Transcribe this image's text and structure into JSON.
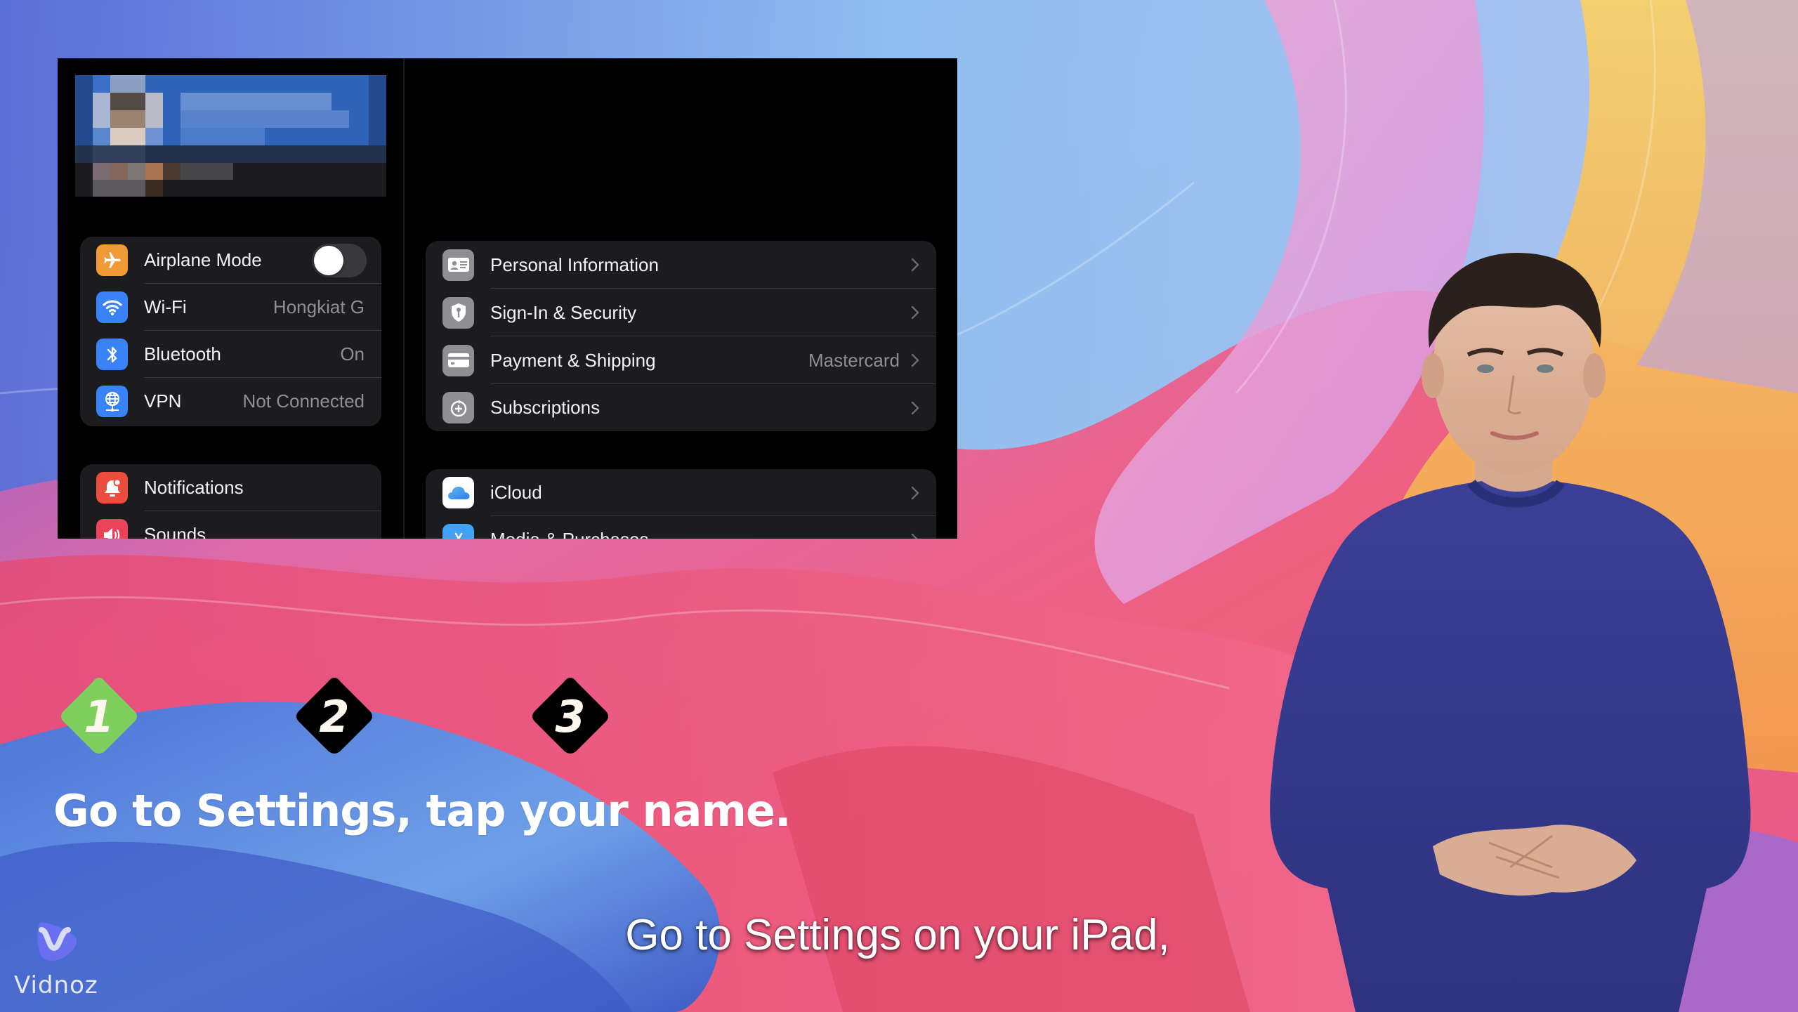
{
  "background": {
    "description": "abstract colorful wavy gradient wallpaper",
    "colors": [
      "#5b7fdc",
      "#8fbff2",
      "#e879b6",
      "#f2c25a",
      "#ee5f7a",
      "#9b6fd8"
    ]
  },
  "settings_panel": {
    "profile": {
      "state": "pixelated/blurred",
      "colors": [
        "#2f63b8",
        "#3f74c9",
        "#6e92d2",
        "#24324d",
        "#1e1e20"
      ]
    },
    "sidebar": {
      "groups": [
        {
          "items": [
            {
              "label": "Airplane Mode",
              "icon": "airplane-icon",
              "icon_color": "#f09a37",
              "toggle": true,
              "toggle_on": false
            },
            {
              "label": "Wi-Fi",
              "icon": "wifi-icon",
              "icon_color": "#3a82f7",
              "value": "Hongkiat G"
            },
            {
              "label": "Bluetooth",
              "icon": "bluetooth-icon",
              "icon_color": "#3a82f7",
              "value": "On"
            },
            {
              "label": "VPN",
              "icon": "vpn-globe-icon",
              "icon_color": "#3a82f7",
              "value": "Not Connected"
            }
          ]
        },
        {
          "items": [
            {
              "label": "Notifications",
              "icon": "bell-icon",
              "icon_color": "#eb4d3d"
            },
            {
              "label": "Sounds",
              "icon": "speaker-icon",
              "icon_color": "#eb445a"
            }
          ]
        }
      ]
    },
    "detail": {
      "groups": [
        {
          "items": [
            {
              "label": "Personal Information",
              "icon": "contact-card-icon",
              "icon_color": "#8e8e93"
            },
            {
              "label": "Sign-In & Security",
              "icon": "shield-key-icon",
              "icon_color": "#8e8e93"
            },
            {
              "label": "Payment & Shipping",
              "icon": "credit-card-icon",
              "icon_color": "#8e8e93",
              "value": "Mastercard"
            },
            {
              "label": "Subscriptions",
              "icon": "subscriptions-icon",
              "icon_color": "#8e8e93"
            }
          ]
        },
        {
          "items": [
            {
              "label": "iCloud",
              "icon": "icloud-icon",
              "icon_color": "#ffffff"
            },
            {
              "label": "Media & Purchases",
              "icon": "app-store-icon",
              "icon_color": "#3fa2f5"
            }
          ]
        }
      ]
    }
  },
  "steps": [
    {
      "number": "1",
      "active": true,
      "color": "#7fcf5f"
    },
    {
      "number": "2",
      "active": false,
      "color": "#000000"
    },
    {
      "number": "3",
      "active": false,
      "color": "#000000"
    }
  ],
  "caption": "Go to Settings, tap your name.",
  "subtitle": "Go to Settings on your iPad,",
  "logo": {
    "name": "Vidnoz",
    "color": "#6a6ff0"
  },
  "presenter": {
    "description": "AI avatar presenter in blue sweater, hands clasped"
  }
}
